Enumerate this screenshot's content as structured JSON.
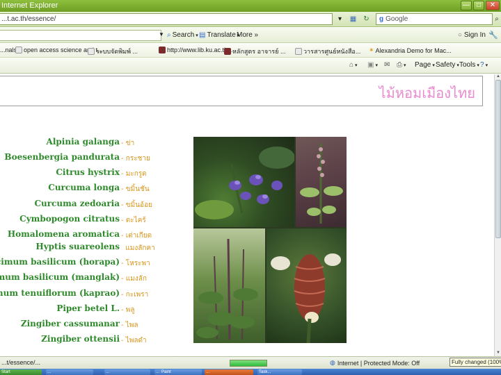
{
  "window": {
    "title": "Internet Explorer",
    "buttons": [
      "—",
      "□",
      "✕"
    ]
  },
  "address": {
    "url": "...t.ac.th/essence/",
    "search_placeholder": "Google"
  },
  "google_toolbar": {
    "search_label": "Search",
    "translate_label": "Translate",
    "more_label": "More »",
    "signin_label": "Sign In"
  },
  "favorites": [
    "...nals",
    "open access science and t...",
    "ระบบจัดพิมพ์ ...",
    "http://www.lib.ku.ac.th...",
    "หลักสูตร อาจารย์ ...",
    "วารสารศูนย์หนังสือ...",
    "Alexandria Demo for Mac..."
  ],
  "command_bar": {
    "page_label": "Page",
    "safety_label": "Safety",
    "tools_label": "Tools"
  },
  "page": {
    "title": "ไม้หอมเมืองไทย",
    "plants": [
      {
        "sci": "Alpinia galanga",
        "thai": "ข่า"
      },
      {
        "sci": "Boesenbergia pandurata",
        "thai": "กระชาย"
      },
      {
        "sci": "Citrus hystrix",
        "thai": "มะกรูด"
      },
      {
        "sci": "Curcuma longa",
        "thai": "ขมิ้นชัน"
      },
      {
        "sci": "Curcuma zedoaria",
        "thai": "ขมิ้นอ้อย"
      },
      {
        "sci": "Cymbopogon citratus",
        "thai": "ตะไคร้"
      },
      {
        "sci": "Homalomena aromatica",
        "thai": "เต่าเกียด"
      },
      {
        "sci": "Hyptis suareolens",
        "thai": "แมงลักคา"
      },
      {
        "sci": "Ocimum basilicum (horapa)",
        "thai": "โหระพา"
      },
      {
        "sci": "Ocimum basilicum (manglak)",
        "thai": "แมงลัก"
      },
      {
        "sci": "Ocimum tenuiflorum (kaprao)",
        "thai": "กะเพรา"
      },
      {
        "sci": "Piper betel L.",
        "thai": "พลู"
      },
      {
        "sci": "Zingiber cassumanar",
        "thai": "ไพล"
      },
      {
        "sci": "Zingiber ottensii",
        "thai": "ไพลดำ"
      }
    ]
  },
  "status": {
    "left_text": "...t/essence/...",
    "progress": 1.0,
    "zone": "Internet | Protected Mode: Off",
    "tooltip": "Fully changed (100%)"
  },
  "taskbar": [
    "Start",
    "...",
    "...",
    "...",
    "Paint",
    "...",
    "Task..."
  ],
  "colors": {
    "title_pink": "#e98ad0",
    "sci_green": "#2f8a2c",
    "thai_orange": "#d8951a",
    "ie_green": "#7aab2c"
  }
}
